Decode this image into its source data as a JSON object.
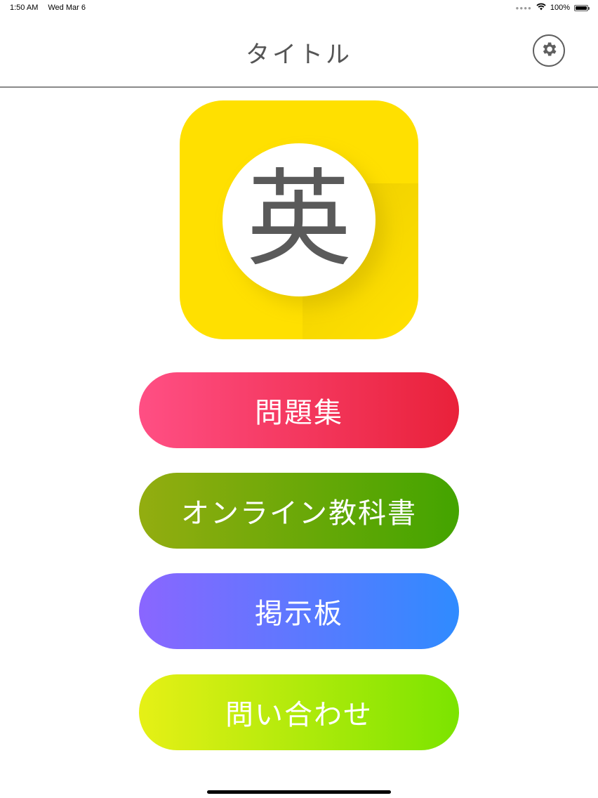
{
  "status_bar": {
    "time": "1:50 AM",
    "date": "Wed Mar 6",
    "battery": "100%",
    "battery_level": 1.0
  },
  "nav": {
    "title": "タイトル"
  },
  "app_icon": {
    "character": "英",
    "background_color": "#ffe000"
  },
  "menu": {
    "items": [
      {
        "label": "問題集"
      },
      {
        "label": "オンライン教科書"
      },
      {
        "label": "掲示板"
      },
      {
        "label": "問い合わせ"
      }
    ]
  }
}
